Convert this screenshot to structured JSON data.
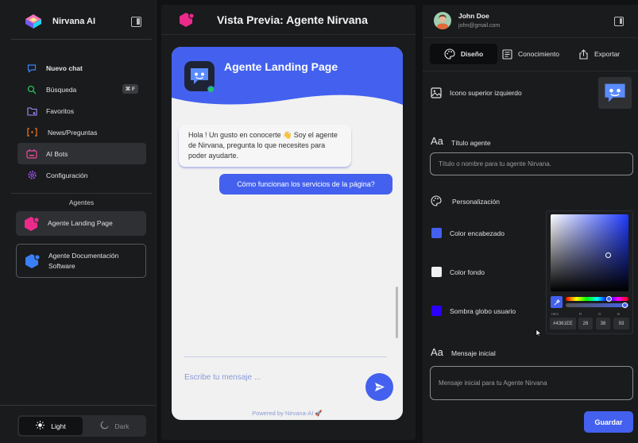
{
  "app": {
    "name": "Nirvana AI"
  },
  "nav": {
    "items": [
      {
        "label": "Nuevo chat",
        "icon": "chat-bubble-icon"
      },
      {
        "label": "Búsqueda",
        "icon": "search-icon",
        "shortcut": "⌘ F"
      },
      {
        "label": "Favoritos",
        "icon": "folder-star-icon"
      },
      {
        "label": "News/Preguntas",
        "icon": "code-brackets-icon"
      },
      {
        "label": "AI Bots",
        "icon": "bot-icon"
      },
      {
        "label": "Configuración",
        "icon": "gear-icon"
      }
    ],
    "active": "AI Bots"
  },
  "agents": {
    "title": "Agentes",
    "items": [
      {
        "name": "Agente Landing Page"
      },
      {
        "name": "Agente Documentación Software"
      }
    ]
  },
  "theme": {
    "light": "Light",
    "dark": "Dark",
    "selected": "Light"
  },
  "preview": {
    "title": "Vista Previa: Agente Nirvana",
    "widget_title": "Agente Landing Page",
    "bot_message": "Hola ! Un gusto en conocerte 👋 Soy el agente de Nirvana, pregunta lo que necesites para poder ayudarte.",
    "user_message": "Cómo funcionan los servicios de la página?",
    "input_placeholder": "Escribe tu mensaje ...",
    "powered_by": "Powered by Nirvana-AI 🚀"
  },
  "user": {
    "name": "John Doe",
    "email": "john@gmail.com"
  },
  "settings": {
    "tabs": [
      {
        "label": "Diseño",
        "icon": "palette-icon"
      },
      {
        "label": "Conocimiento",
        "icon": "document-icon"
      },
      {
        "label": "Exportar",
        "icon": "export-icon"
      }
    ],
    "active_tab": "Diseño",
    "top_left_icon_label": "Icono superior izquierdo",
    "agent_title_label": "Título agente",
    "agent_title_placeholder": "Título o nombre para tu agente Nirvana.",
    "personalization_label": "Personalización",
    "header_color_label": "Color encabezado",
    "background_color_label": "Color fondo",
    "user_bubble_shadow_label": "Sombra globo usuario",
    "initial_message_label": "Mensaje inicial",
    "initial_message_placeholder": "Mensaje inicial para tu Agente Nirvana",
    "save_label": "Guardar"
  },
  "colors": {
    "header": "#4361EE",
    "background": "#F1F1F1",
    "user_bubble_shadow": "#2B00FF",
    "accent": "#4361EE"
  },
  "color_picker": {
    "hex_label": "HEX",
    "r_label": "R",
    "g_label": "G",
    "b_label": "B",
    "hex": "#4361EE",
    "r": "26",
    "g": "38",
    "b": "93"
  }
}
